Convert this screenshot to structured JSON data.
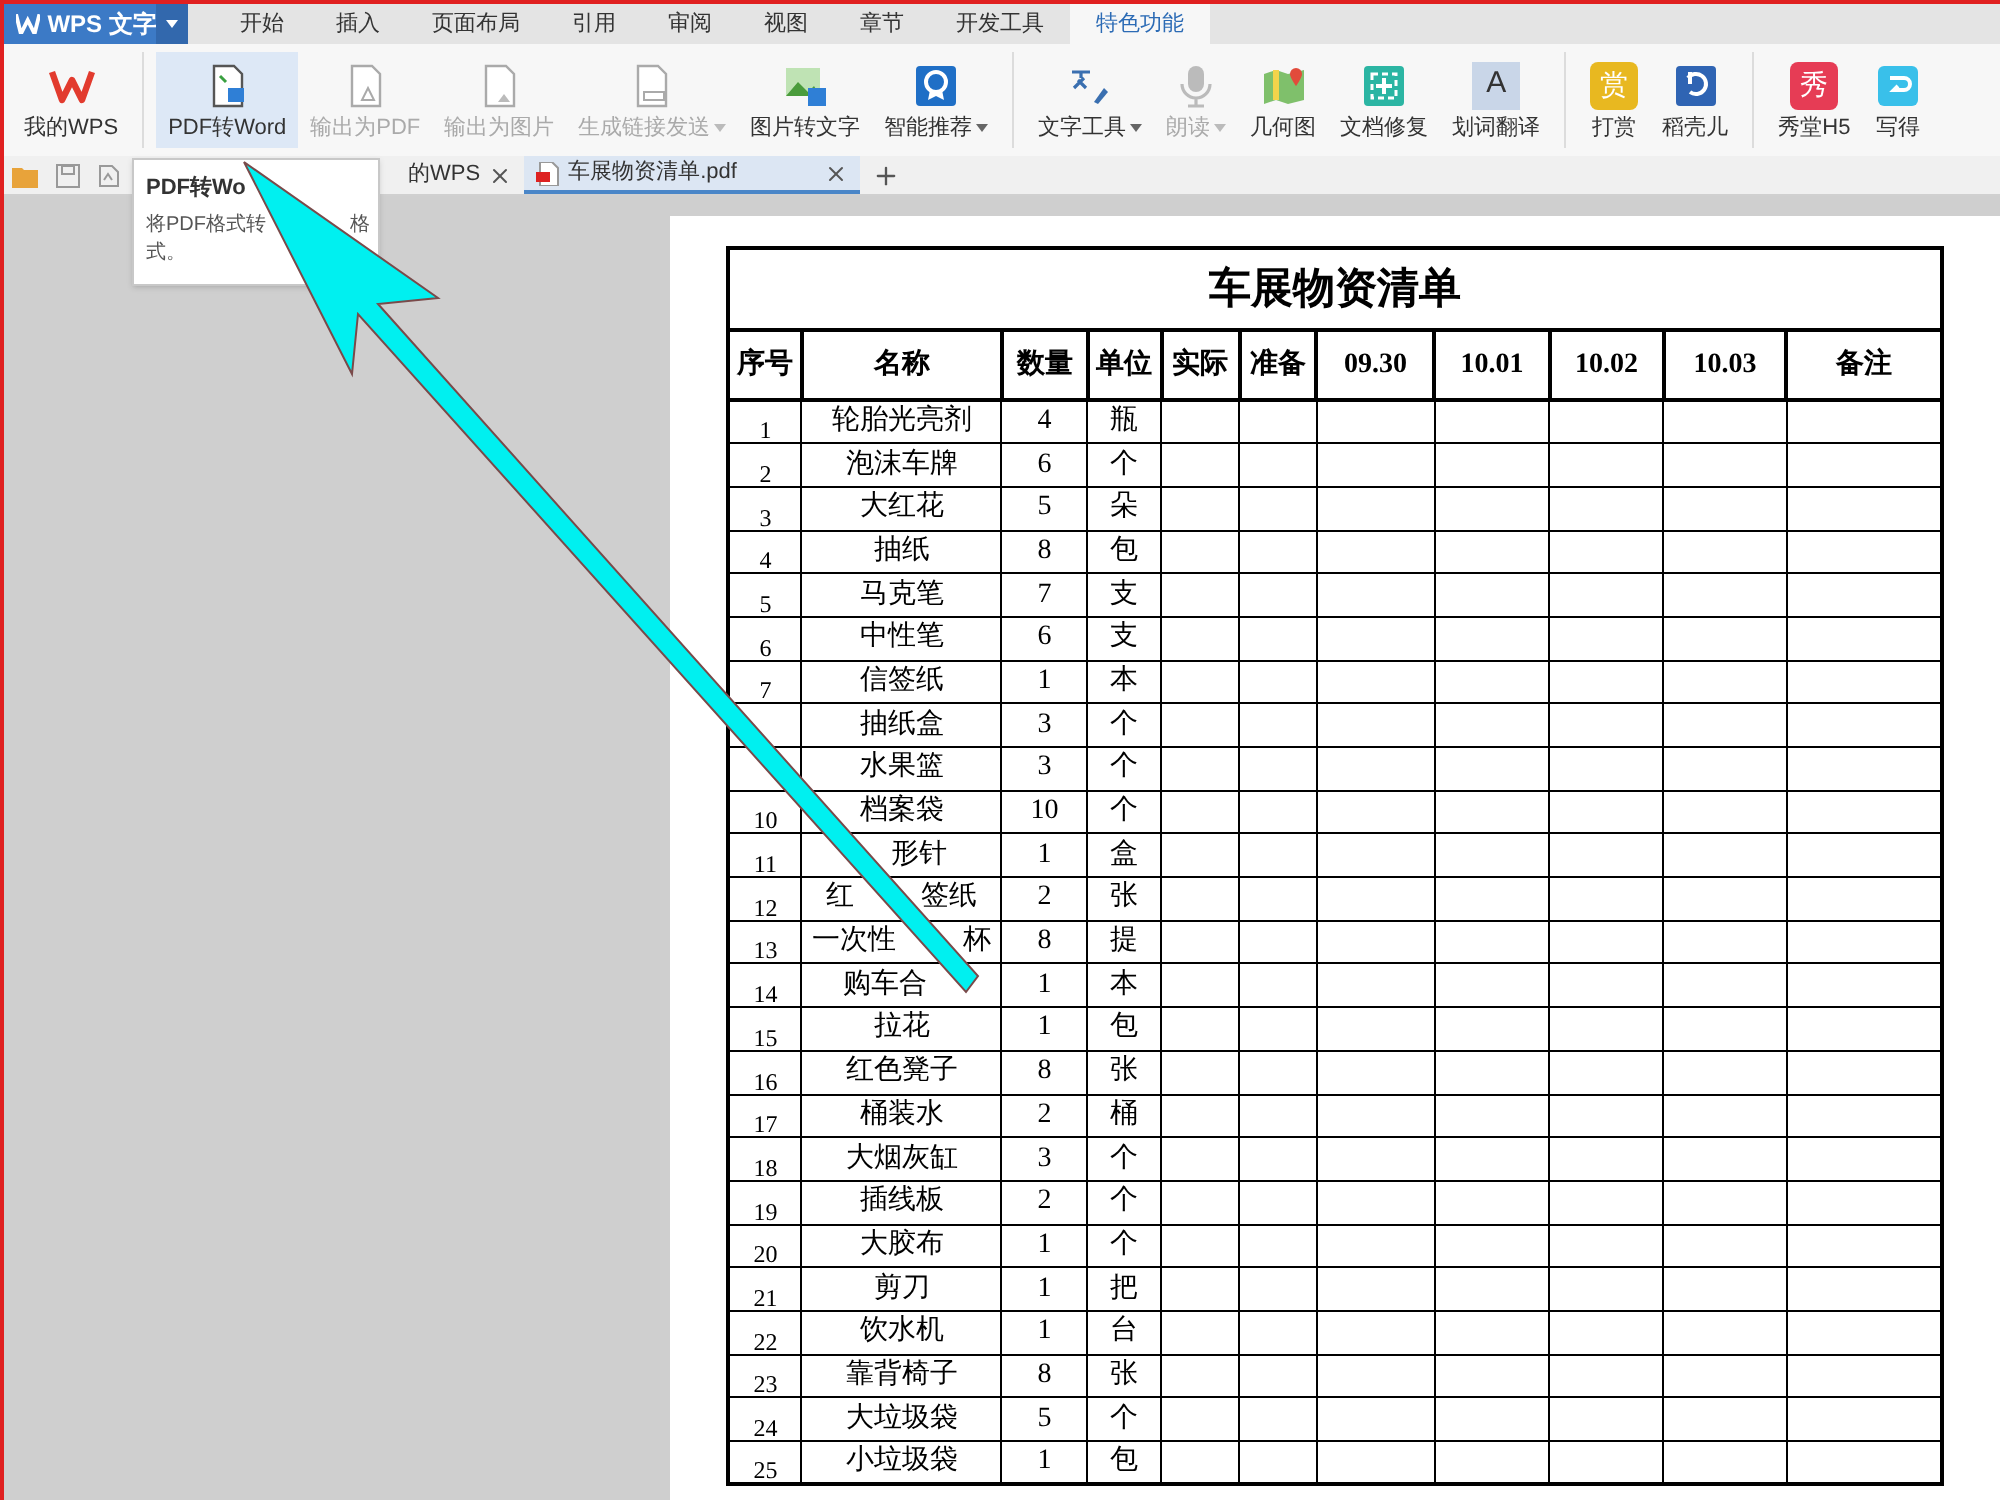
{
  "app": {
    "name": "WPS 文字"
  },
  "menu_tabs": [
    {
      "label": "开始",
      "selected": false
    },
    {
      "label": "插入",
      "selected": false
    },
    {
      "label": "页面布局",
      "selected": false
    },
    {
      "label": "引用",
      "selected": false
    },
    {
      "label": "审阅",
      "selected": false
    },
    {
      "label": "视图",
      "selected": false
    },
    {
      "label": "章节",
      "selected": false
    },
    {
      "label": "开发工具",
      "selected": false
    },
    {
      "label": "特色功能",
      "selected": true
    }
  ],
  "ribbon_groups": [
    {
      "items": [
        {
          "label": "我的WPS",
          "disabled": false,
          "dropdown": false,
          "highlighted": false
        }
      ]
    },
    {
      "items": [
        {
          "label": "PDF转Word",
          "disabled": false,
          "dropdown": false,
          "highlighted": true
        },
        {
          "label": "输出为PDF",
          "disabled": true,
          "dropdown": false,
          "highlighted": false
        },
        {
          "label": "输出为图片",
          "disabled": true,
          "dropdown": false,
          "highlighted": false
        },
        {
          "label": "生成链接发送",
          "disabled": true,
          "dropdown": true,
          "highlighted": false
        },
        {
          "label": "图片转文字",
          "disabled": false,
          "dropdown": false,
          "highlighted": false
        },
        {
          "label": "智能推荐",
          "disabled": false,
          "dropdown": true,
          "highlighted": false
        }
      ]
    },
    {
      "items": [
        {
          "label": "文字工具",
          "disabled": false,
          "dropdown": true,
          "highlighted": false
        },
        {
          "label": "朗读",
          "disabled": true,
          "dropdown": true,
          "highlighted": false
        },
        {
          "label": "几何图",
          "disabled": false,
          "dropdown": false,
          "highlighted": false
        },
        {
          "label": "文档修复",
          "disabled": false,
          "dropdown": false,
          "highlighted": false
        },
        {
          "label": "划词翻译",
          "disabled": false,
          "dropdown": false,
          "highlighted": false,
          "icon_text": "A"
        }
      ]
    },
    {
      "items": [
        {
          "label": "打赏",
          "disabled": false,
          "dropdown": false,
          "highlighted": false,
          "icon_text": "赏"
        },
        {
          "label": "稻壳儿",
          "disabled": false,
          "dropdown": false,
          "highlighted": false
        }
      ]
    },
    {
      "items": [
        {
          "label": "秀堂H5",
          "disabled": false,
          "dropdown": false,
          "highlighted": false,
          "icon_text": "秀"
        },
        {
          "label": "写得",
          "disabled": false,
          "dropdown": false,
          "highlighted": false
        }
      ]
    }
  ],
  "doc_tabs": [
    {
      "label": "的WPS",
      "selected": false
    },
    {
      "label": "车展物资清单.pdf",
      "selected": true
    }
  ],
  "tooltip": {
    "title": "PDF转Wo",
    "description_parts": [
      "将PDF格式转",
      "格式。"
    ]
  },
  "document": {
    "title": "车展物资清单",
    "columns": [
      "序号",
      "名称",
      "数量",
      "单位",
      "实际",
      "准备",
      "09.30",
      "10.01",
      "10.02",
      "10.03",
      "备注"
    ],
    "rows": [
      [
        "1",
        "轮胎光亮剂",
        "4",
        "瓶"
      ],
      [
        "2",
        "泡沫车牌",
        "6",
        "个"
      ],
      [
        "3",
        "大红花",
        "5",
        "朵"
      ],
      [
        "4",
        "抽纸",
        "8",
        "包"
      ],
      [
        "5",
        "马克笔",
        "7",
        "支"
      ],
      [
        "6",
        "中性笔",
        "6",
        "支"
      ],
      [
        "7",
        "信签纸",
        "1",
        "本"
      ],
      [
        null,
        "抽纸盒",
        "3",
        "个"
      ],
      [
        null,
        "水果篮",
        "3",
        "个"
      ],
      [
        "10",
        "档案袋",
        "10",
        "个"
      ],
      [
        "11",
        [
          null,
          "形针"
        ],
        "1",
        "盒"
      ],
      [
        "12",
        [
          "红",
          null,
          "签纸"
        ],
        "2",
        "张"
      ],
      [
        "13",
        [
          "一次性",
          null,
          "杯"
        ],
        "8",
        "提"
      ],
      [
        "14",
        [
          "购车合",
          null
        ],
        "1",
        "本"
      ],
      [
        "15",
        "拉花",
        "1",
        "包"
      ],
      [
        "16",
        "红色凳子",
        "8",
        "张"
      ],
      [
        "17",
        "桶装水",
        "2",
        "桶"
      ],
      [
        "18",
        "大烟灰缸",
        "3",
        "个"
      ],
      [
        "19",
        "插线板",
        "2",
        "个"
      ],
      [
        "20",
        "大胶布",
        "1",
        "个"
      ],
      [
        "21",
        "剪刀",
        "1",
        "把"
      ],
      [
        "22",
        "饮水机",
        "1",
        "台"
      ],
      [
        "23",
        "靠背椅子",
        "8",
        "张"
      ],
      [
        "24",
        "大垃圾袋",
        "5",
        "个"
      ],
      [
        "25",
        "小垃圾袋",
        "1",
        "包"
      ]
    ]
  }
}
